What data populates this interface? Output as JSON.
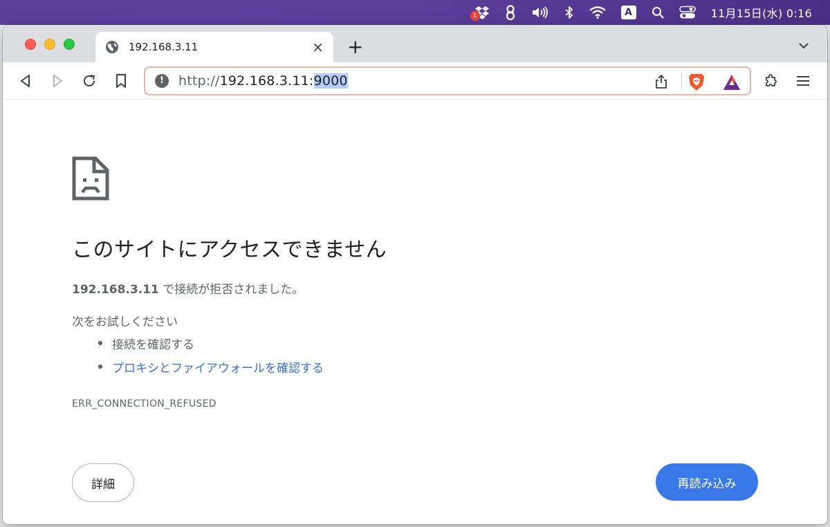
{
  "menubar": {
    "dropbox_badge": "1",
    "input_source": "A",
    "clock": "11月15日(水) 0:16"
  },
  "browser": {
    "tab": {
      "title": "192.168.3.11"
    },
    "new_tab_label": "+",
    "tab_close_label": "×",
    "omnibox": {
      "info_glyph": "!",
      "scheme": "http://",
      "host": "192.168.3.11:",
      "port_selected": "9000"
    }
  },
  "error_page": {
    "title": "このサイトにアクセスできません",
    "host": "192.168.3.11",
    "description": " で接続が拒否されました。",
    "suggestions_title": "次をお試しください",
    "suggestions": [
      {
        "label": "接続を確認する",
        "is_link": false
      },
      {
        "label": "プロキシとファイアウォールを確認する",
        "is_link": true
      }
    ],
    "error_code": "ERR_CONNECTION_REFUSED",
    "details_label": "詳細",
    "reload_label": "再読み込み"
  },
  "colors": {
    "menubar": "#5a3f99",
    "link": "#3a6fd8",
    "primary_button": "#3b78e7",
    "omnibox_focus_border": "#e8b6a8"
  }
}
